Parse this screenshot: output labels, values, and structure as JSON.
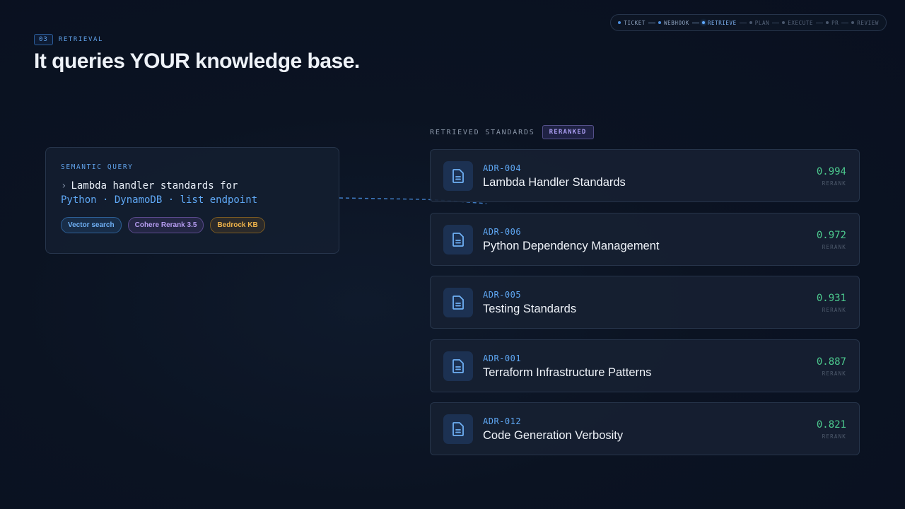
{
  "section": {
    "number": "03",
    "label": "RETRIEVAL"
  },
  "title": "It queries YOUR knowledge base.",
  "pipeline": [
    {
      "label": "TICKET",
      "state": "done"
    },
    {
      "label": "WEBHOOK",
      "state": "done"
    },
    {
      "label": "RETRIEVE",
      "state": "active"
    },
    {
      "label": "PLAN",
      "state": "pending"
    },
    {
      "label": "EXECUTE",
      "state": "pending"
    },
    {
      "label": "PR",
      "state": "pending"
    },
    {
      "label": "REVIEW",
      "state": "pending"
    }
  ],
  "query": {
    "label": "SEMANTIC QUERY",
    "prompt_symbol": "›",
    "line1": "Lambda handler standards for",
    "line2": "Python · DynamoDB · list endpoint",
    "chips": [
      "Vector search",
      "Cohere Rerank 3.5",
      "Bedrock KB"
    ]
  },
  "results": {
    "label": "RETRIEVED STANDARDS",
    "badge": "RERANKED",
    "score_label": "RERANK",
    "items": [
      {
        "id": "ADR-004",
        "title": "Lambda Handler Standards",
        "score": "0.994"
      },
      {
        "id": "ADR-006",
        "title": "Python Dependency Management",
        "score": "0.972"
      },
      {
        "id": "ADR-005",
        "title": "Testing Standards",
        "score": "0.931"
      },
      {
        "id": "ADR-001",
        "title": "Terraform Infrastructure Patterns",
        "score": "0.887"
      },
      {
        "id": "ADR-012",
        "title": "Code Generation Verbosity",
        "score": "0.821"
      }
    ]
  },
  "colors": {
    "accent": "#5fa8f5",
    "score": "#4cc98e",
    "background": "#0b1322"
  },
  "icons": {
    "document": "document-icon"
  }
}
